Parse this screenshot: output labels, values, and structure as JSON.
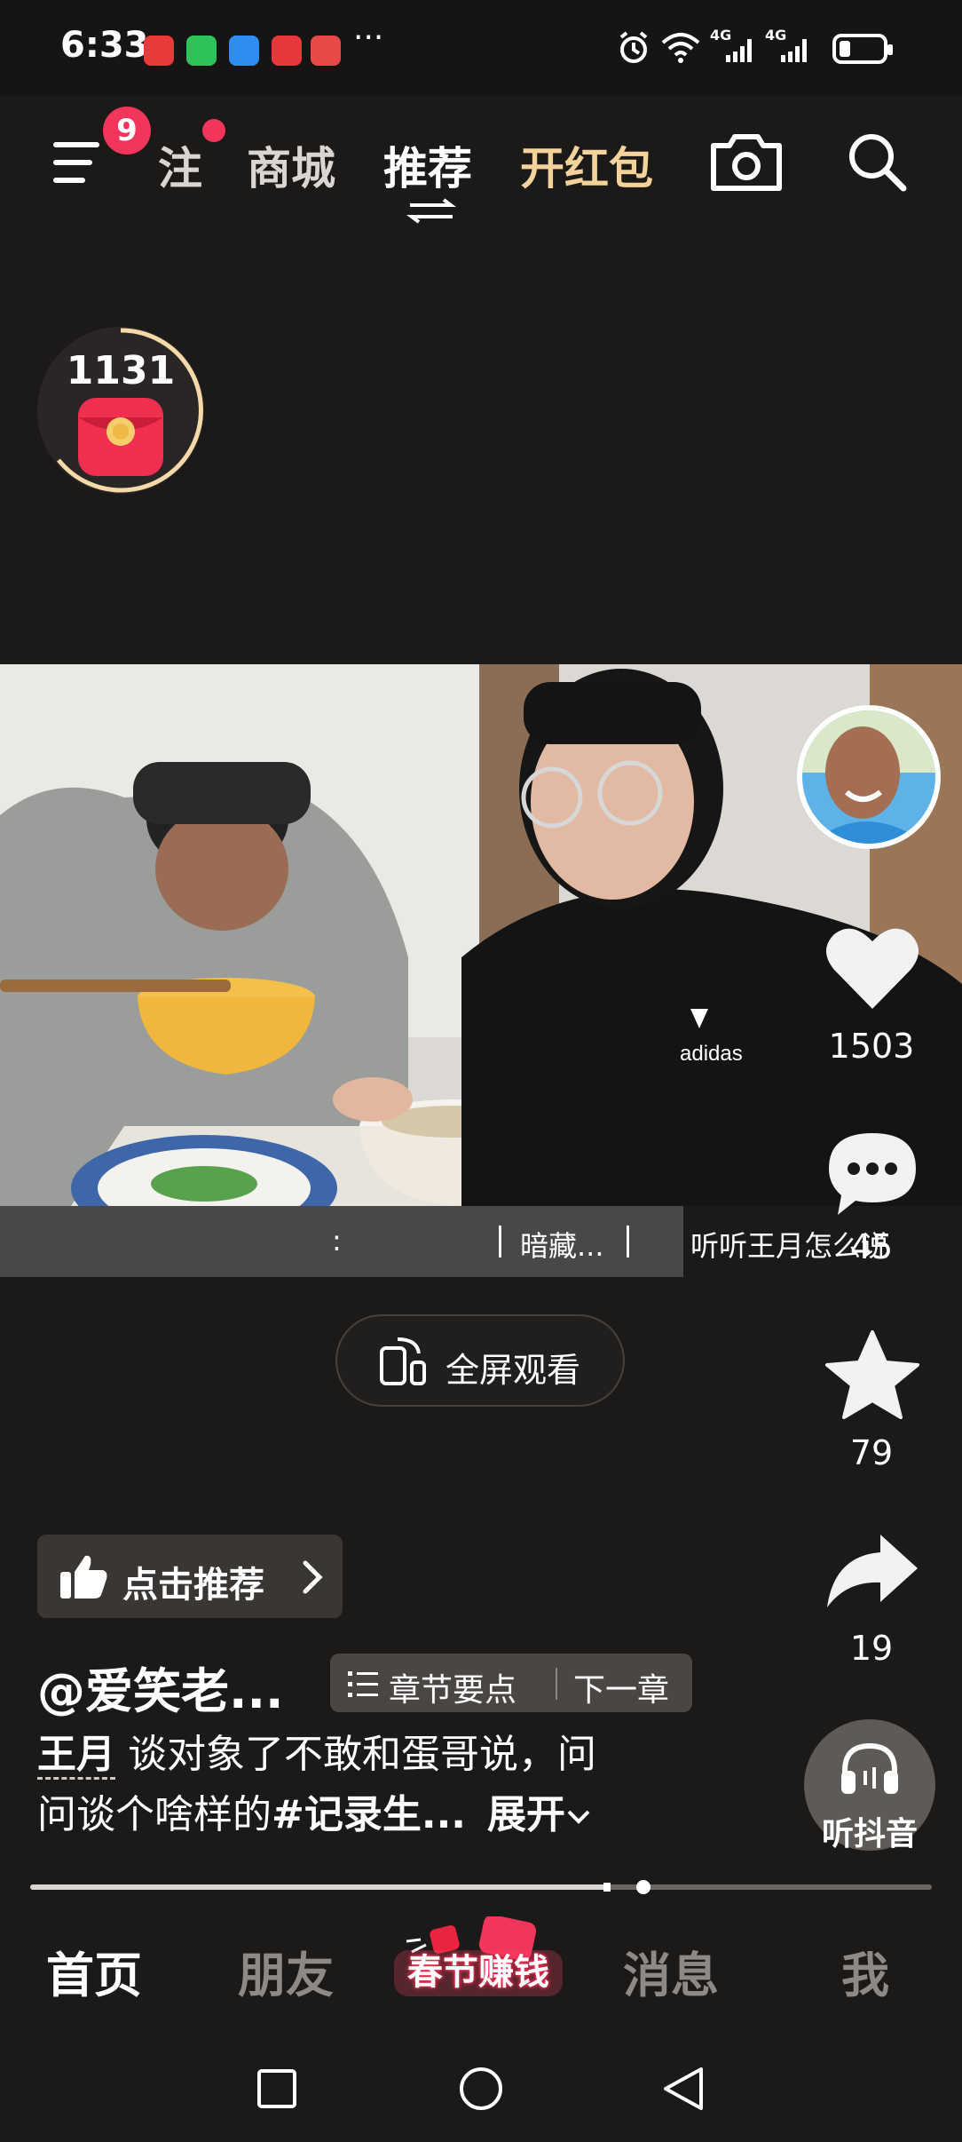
{
  "status_bar": {
    "time": "6:33",
    "more": "···",
    "network_1": "4G",
    "network_2": "4G"
  },
  "top_nav": {
    "menu_badge": "9",
    "tabs": [
      {
        "label": "注"
      },
      {
        "label": "商城"
      },
      {
        "label": "推荐"
      },
      {
        "label": "开红包"
      }
    ],
    "active_tab": "推荐"
  },
  "timer_widget": {
    "count": "1131"
  },
  "video": {
    "subtitle_left": ":",
    "subtitle_mid": "暗藏...",
    "subtitle_right": "听听王月怎么说"
  },
  "right_rail": {
    "likes": "1503",
    "comments": "45",
    "favorites": "79",
    "shares": "19",
    "listen_label": "听抖音"
  },
  "fullscreen_button": {
    "label": "全屏观看"
  },
  "recommend_chip": {
    "label": "点击推荐"
  },
  "post": {
    "author": "@爱笑老...",
    "chapter_points": "章节要点",
    "next_chapter": "下一章",
    "mention": "王月",
    "desc_line1": "谈对象了不敢和蛋哥说，问",
    "desc_line2": "问谈个啥样的",
    "hashtag": "#记录生...",
    "expand": "展开"
  },
  "progress": {
    "played_fraction": 0.64,
    "buffered_fraction": 0.68
  },
  "bottom_tabs": {
    "home": "首页",
    "friends": "朋友",
    "spring": "春节赚钱",
    "messages": "消息",
    "me": "我"
  },
  "colors": {
    "background": "#1c1a19",
    "gold": "#f3d39a",
    "badge_red": "#f2355a",
    "tab_inactive": "#8d8986"
  }
}
